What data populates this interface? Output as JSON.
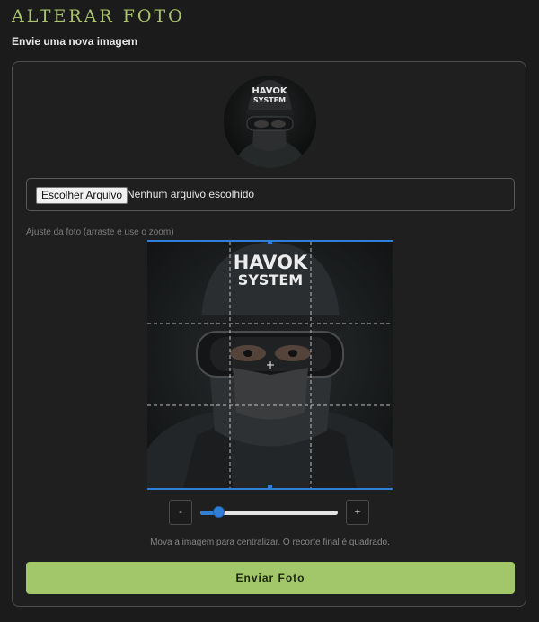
{
  "header": {
    "title": "ALTERAR FOTO",
    "subtitle": "Envie uma nova imagem"
  },
  "file_input": {
    "button_label": "Escolher Arquivo",
    "status": "Nenhum arquivo escolhido"
  },
  "cropper": {
    "label": "Ajuste da foto (arraste e use o zoom)",
    "cap_text_line1": "HAVOK",
    "cap_text_line2": "SYSTEM",
    "zoom_out_label": "-",
    "zoom_in_label": "+",
    "zoom_level": 0.1,
    "hint": "Mova a imagem para centralizar. O recorte final é quadrado.",
    "accent_color": "#2f7fd6"
  },
  "actions": {
    "submit_label": "Enviar Foto"
  },
  "colors": {
    "title_green": "#a9c46c",
    "button_green": "#a2c66a"
  },
  "icons": {
    "crosshair": "crosshair-icon"
  }
}
